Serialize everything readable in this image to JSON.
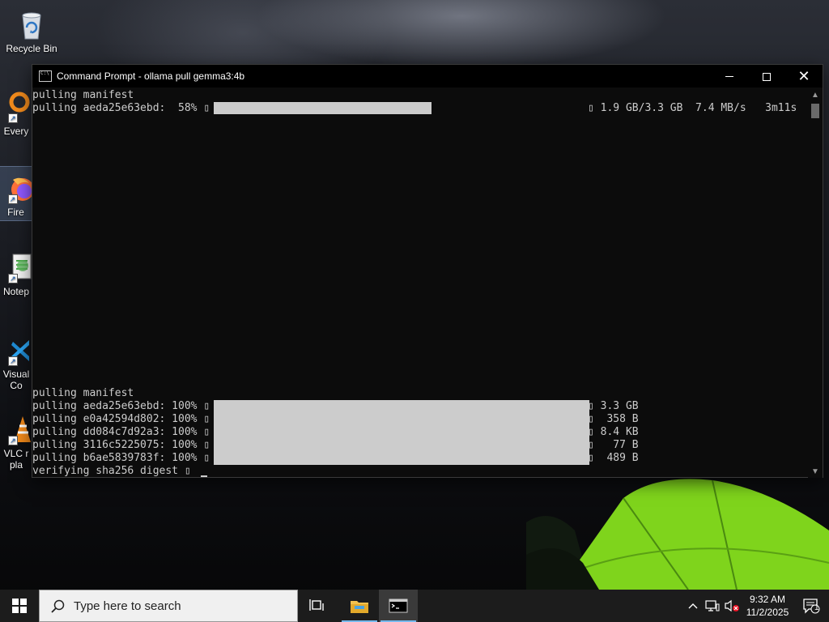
{
  "desktop": {
    "icons": [
      {
        "label": "Recycle Bin",
        "icon": "recycle-bin-icon"
      },
      {
        "label": "Every",
        "icon": "everything-icon"
      },
      {
        "label": "Fire",
        "icon": "firefox-icon"
      },
      {
        "label": "Notep",
        "icon": "notepad-icon"
      },
      {
        "label": "Visual\nCo",
        "icon": "vscode-icon"
      },
      {
        "label": "VLC r\npla",
        "icon": "vlc-icon"
      }
    ]
  },
  "cmd_window": {
    "title": "Command Prompt - ollama  pull gemma3:4b",
    "lines": [
      "pulling manifest",
      "pulling aeda25e63ebd:  58% ▯",
      "pulling manifest",
      "pulling aeda25e63ebd: 100% ▯",
      "pulling e0a42594d802: 100% ▯",
      "pulling dd084c7d92a3: 100% ▯",
      "pulling 3116c5225075: 100% ▯",
      "pulling b6ae5839783f: 100% ▯",
      "verifying sha256 digest ▯"
    ],
    "progress_first": {
      "status": "▯ 1.9 GB/3.3 GB  7.4 MB/s   3m11s",
      "percent": 58
    },
    "completed_sizes": [
      "▯ 3.3 GB",
      "▯  358 B",
      "▯ 8.4 KB",
      "▯   77 B",
      "▯  489 B"
    ]
  },
  "taskbar": {
    "search_placeholder": "Type here to search",
    "clock_time": "9:32 AM",
    "clock_date": "11/2/2025",
    "notification_count": "1"
  }
}
